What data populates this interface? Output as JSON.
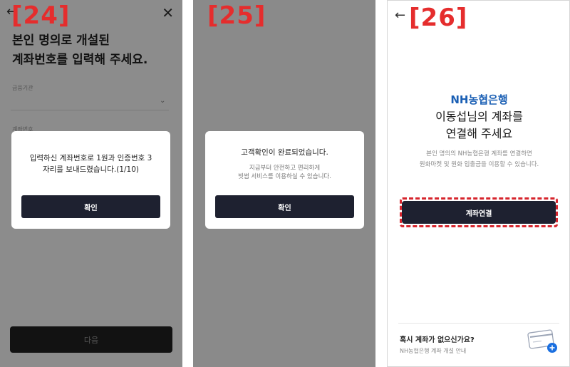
{
  "screen24": {
    "step": "[24]",
    "title_line1": "본인 명의로 개설된",
    "title_line2": "계좌번호를 입력해 주세요.",
    "bank_field_label": "금융기관",
    "account_field_label": "계좌번호",
    "dialog_message_line1": "입력하신 계좌번호로 1원과 인증번호 3",
    "dialog_message_line2": "자리를 보내드렸습니다.(1/10)",
    "dialog_ok": "확인",
    "next_button": "다음"
  },
  "screen25": {
    "step": "[25]",
    "dialog_message": "고객확인이 완료되었습니다.",
    "dialog_sub_line1": "지금부터 안전하고 편리하게",
    "dialog_sub_line2": "빗썸 서비스를 이용하실 수 있습니다.",
    "dialog_ok": "확인"
  },
  "screen26": {
    "step": "[26]",
    "bank_logo": "NH농협은행",
    "title_line1": "이동섭님의 계좌를",
    "title_line2": "연결해 주세요",
    "desc_line1": "본인 명의의 NH농협은행 계좌를 연결하면",
    "desc_line2": "원화마켓 및 원화 입출금을 이용할 수 있습니다.",
    "connect_button": "계좌연결",
    "no_account_title": "혹시 계좌가 없으신가요?",
    "no_account_sub": "NH농협은행 계좌 개설 안내"
  },
  "colors": {
    "step_label": "#e52d2d",
    "button_dark": "#1e2130",
    "nh_blue": "#1a5fb4",
    "highlight": "#d6252d"
  }
}
